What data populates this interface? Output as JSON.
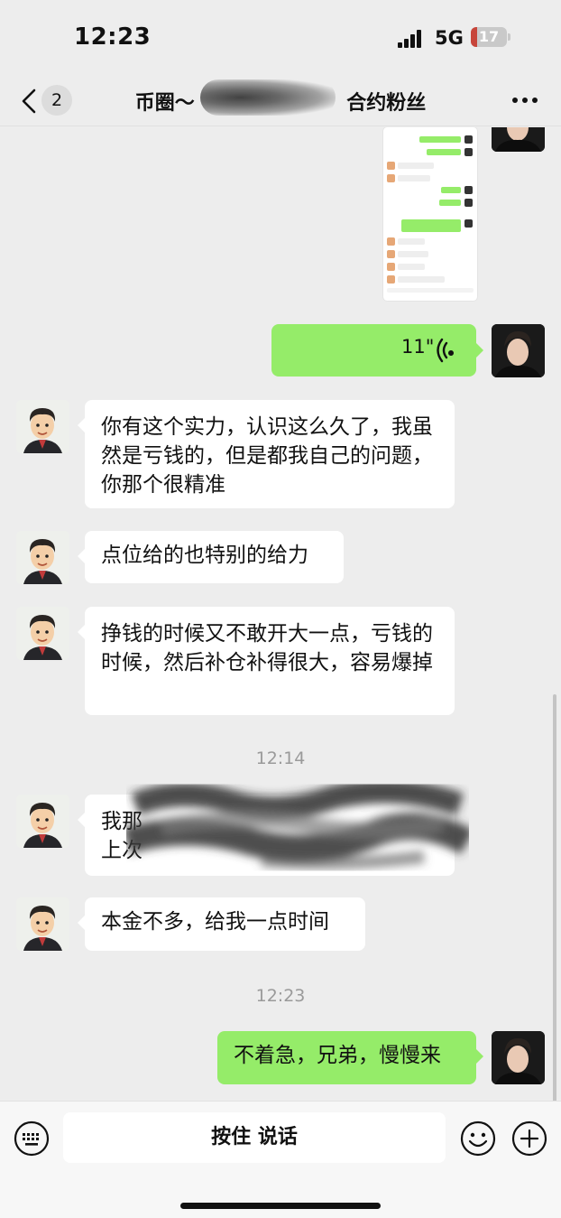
{
  "status_bar": {
    "time": "12:23",
    "network": "5G",
    "battery_text": "17",
    "battery_level": 0.17,
    "battery_color": "#c7453a"
  },
  "nav": {
    "back_icon": "chevron-left-icon",
    "unread_count": "2",
    "title_left": "币圈～",
    "title_right": "合约粉丝",
    "more_icon": "more-dots-icon"
  },
  "messages": {
    "voice_duration": "11\"",
    "m1": "你有这个实力，认识这么久了，我虽然是亏钱的，但是都我自己的问题，你那个很精准",
    "m2": "点位给的也特别的给力",
    "m3": "挣钱的时候又不敢开大一点，亏钱的时候，然后补仓补得很大，容易爆掉",
    "time_1": "12:14",
    "m4_line1": "我那",
    "m4_line2": "上次",
    "m5": "本金不多，给我一点时间",
    "time_2": "12:23",
    "m6": "不着急，兄弟，慢慢来"
  },
  "input_bar": {
    "hold_to_talk": "按住 说话",
    "keyboard_icon": "keyboard-icon",
    "emoji_icon": "emoji-icon",
    "plus_icon": "plus-icon"
  },
  "colors": {
    "self_bubble": "#95ec69",
    "other_bubble": "#ffffff",
    "background": "#ededed"
  }
}
